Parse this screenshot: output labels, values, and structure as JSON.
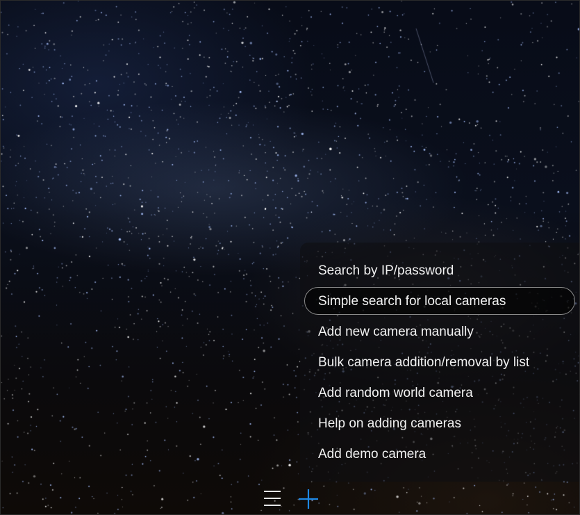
{
  "menu": {
    "items": [
      {
        "label": "Search by IP/password",
        "selected": false
      },
      {
        "label": "Simple search for local cameras",
        "selected": true
      },
      {
        "label": "Add new camera manually",
        "selected": false
      },
      {
        "label": "Bulk camera addition/removal by list",
        "selected": false
      },
      {
        "label": "Add random world camera",
        "selected": false
      },
      {
        "label": "Help on adding cameras",
        "selected": false
      },
      {
        "label": "Add demo camera",
        "selected": false
      }
    ]
  },
  "toolbar": {
    "menu_icon": "hamburger-menu-icon",
    "add_icon": "plus-icon",
    "accent_color": "#1e88e5",
    "icon_color": "#e6e6e6"
  },
  "colors": {
    "menu_text": "#f2f2f2",
    "selected_border": "#8a8a8a"
  }
}
